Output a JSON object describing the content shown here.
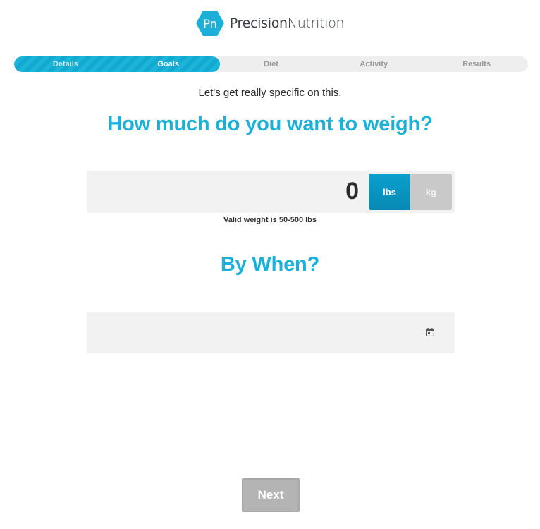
{
  "brand": {
    "logo_text": "Pn",
    "name_part1": "Precision",
    "name_part2": "Nutrition",
    "color": "#1cb0d8"
  },
  "progress": {
    "steps": [
      {
        "label": "Details",
        "state": "done"
      },
      {
        "label": "Goals",
        "state": "current"
      },
      {
        "label": "Diet",
        "state": "upcoming"
      },
      {
        "label": "Activity",
        "state": "upcoming"
      },
      {
        "label": "Results",
        "state": "upcoming"
      }
    ],
    "completed_fraction": 0.4
  },
  "intro": "Let's get really specific on this.",
  "weight_question": "How much do you want to weigh?",
  "weight": {
    "value": "0",
    "units": {
      "lbs": "lbs",
      "kg": "kg"
    },
    "selected_unit": "lbs",
    "hint": "Valid weight is 50-500 lbs"
  },
  "date_question": "By When?",
  "date": {
    "value": "",
    "icon": "calendar-icon"
  },
  "next_label": "Next",
  "colors": {
    "accent": "#1cb0d8",
    "button_active": "#0a97c4",
    "button_disabled": "#b4b4b4",
    "field_bg": "#f2f2f2"
  }
}
